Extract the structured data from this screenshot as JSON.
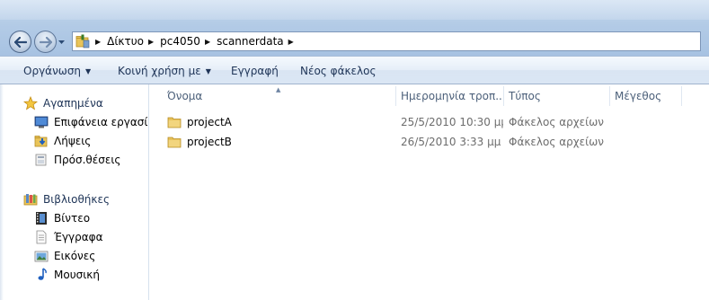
{
  "address": {
    "crumbs": [
      "Δίκτυο",
      "pc4050",
      "scannerdata"
    ]
  },
  "toolbar": {
    "organize": "Οργάνωση",
    "share_with": "Κοινή χρήση με",
    "burn": "Εγγραφή",
    "new_folder": "Νέος φάκελος"
  },
  "nav": {
    "favorites": {
      "label": "Αγαπημένα",
      "items": [
        "Επιφάνεια εργασίας",
        "Λήψεις",
        "Πρόσ.θέσεις"
      ]
    },
    "libraries": {
      "label": "Βιβλιοθήκες",
      "items": [
        "Βίντεο",
        "Έγγραφα",
        "Εικόνες",
        "Μουσική"
      ]
    }
  },
  "columns": {
    "name": "Όνομα",
    "date": "Ημερομηνία τροπ...",
    "type": "Τύπος",
    "size": "Μέγεθος"
  },
  "files": [
    {
      "name": "projectA",
      "date": "25/5/2010 10:30 μμ",
      "type": "Φάκελος αρχείων",
      "size": ""
    },
    {
      "name": "projectB",
      "date": "26/5/2010 3:33 μμ",
      "type": "Φάκελος αρχείων",
      "size": ""
    }
  ],
  "icons": {
    "back": "back-arrow-icon",
    "forward": "forward-arrow-icon",
    "folder": "folder-icon",
    "star": "star-icon"
  },
  "colors": {
    "accent": "#1e3457",
    "glass": "#b3cbe6",
    "folder": "#e8c25a"
  }
}
